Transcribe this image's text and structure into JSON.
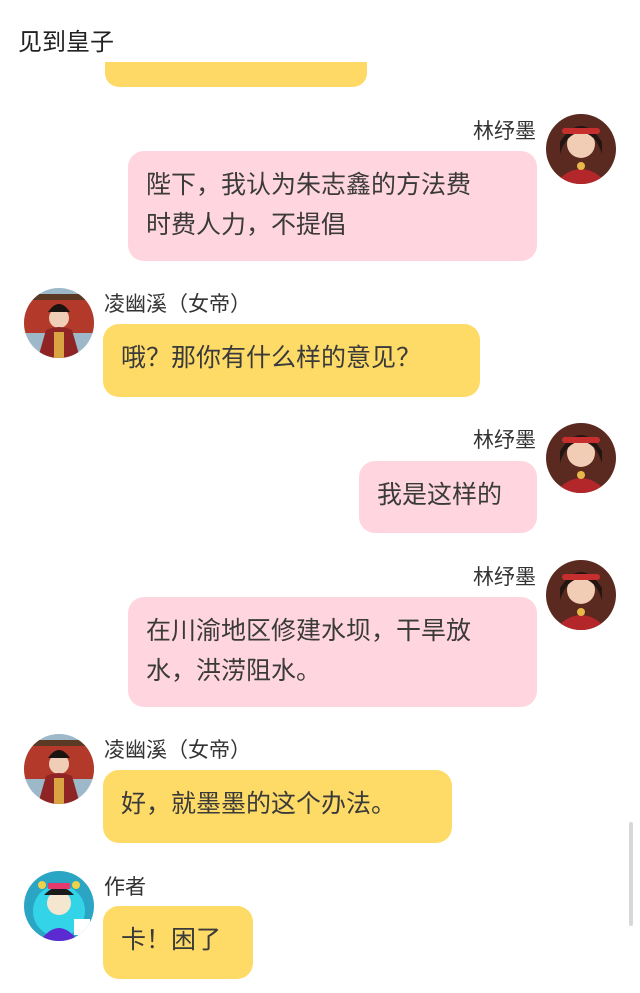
{
  "header": {
    "title": "见到皇子"
  },
  "colors": {
    "pink_bubble": "#ffd6df",
    "yellow_bubble": "#fedb67",
    "background": "#ffffff"
  },
  "messages": [
    {
      "sender": "林纾墨",
      "side": "right",
      "text": "陛下，我认为朱志鑫的方法费\n时费人力，不提倡"
    },
    {
      "sender": "凌幽溪（女帝）",
      "side": "left",
      "text": "哦？那你有什么样的意见？"
    },
    {
      "sender": "林纾墨",
      "side": "right",
      "text": "我是这样的"
    },
    {
      "sender": "林纾墨",
      "side": "right",
      "text": "在川渝地区修建水坝，干旱放\n水，洪涝阻水。"
    },
    {
      "sender": "凌幽溪（女帝）",
      "side": "left",
      "text": "好，就墨墨的这个办法。"
    },
    {
      "sender": "作者",
      "side": "left",
      "text": "卡！困了"
    }
  ]
}
